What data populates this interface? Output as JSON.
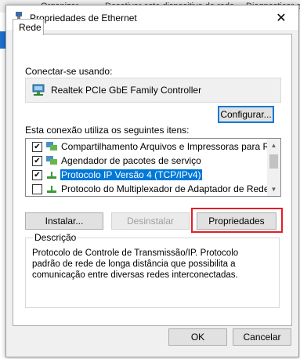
{
  "background": {
    "items": [
      "Organizar",
      "Desativar este dispositivo de rede",
      "Diagnosticar est"
    ]
  },
  "dialog": {
    "title": "Propriedades de Ethernet",
    "close_glyph": "✕",
    "tab": "Rede",
    "connect_using_label": "Conectar-se usando:",
    "adapter_name": "Realtek PCIe GbE Family Controller",
    "configure_button": "Configurar...",
    "items_label": "Esta conexão utiliza os seguintes itens:",
    "items": [
      {
        "checked": true,
        "label": "Compartilhamento Arquivos e Impressoras para Redes",
        "icon": "network-service-icon"
      },
      {
        "checked": true,
        "label": "Agendador de pacotes de serviço",
        "icon": "network-service-icon"
      },
      {
        "checked": true,
        "label": "Protocolo IP Versão 4 (TCP/IPv4)",
        "icon": "protocol-icon",
        "selected": true
      },
      {
        "checked": false,
        "label": "Protocolo do Multiplexador de Adaptador de Rede da M",
        "icon": "protocol-icon"
      }
    ],
    "install_button": "Instalar...",
    "uninstall_button": "Desinstalar",
    "properties_button": "Propriedades",
    "description_label": "Descrição",
    "description_text": "Protocolo de Controle de Transmissão/IP. Protocolo padrão de rede de longa distância que possibilita a comunicação entre diversas redes interconectadas.",
    "ok_button": "OK",
    "cancel_button": "Cancelar",
    "colors": {
      "highlight": "#e21f26",
      "selection": "#0078d7"
    }
  }
}
